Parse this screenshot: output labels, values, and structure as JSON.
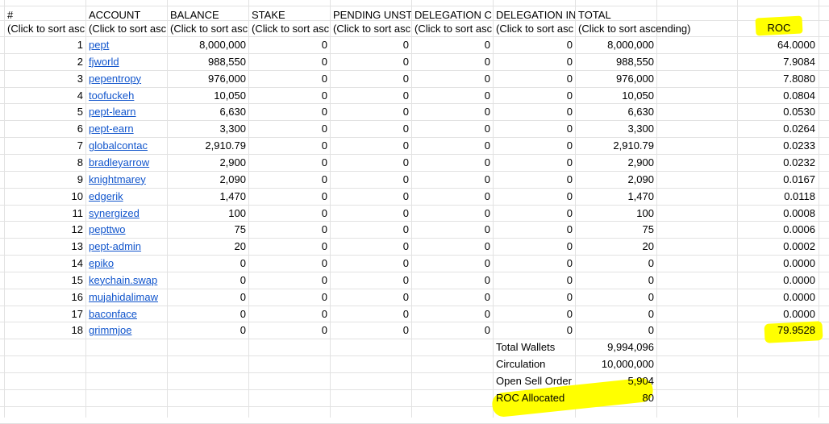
{
  "headers": [
    "#",
    "ACCOUNT",
    "BALANCE",
    "STAKE",
    "PENDING UNST",
    "DELEGATION C",
    "DELEGATION IN",
    "TOTAL",
    "",
    "ROC"
  ],
  "subheaders": [
    "(Click to sort asc",
    "(Click to sort asc",
    "(Click to sort asc",
    "(Click to sort asc",
    "(Click to sort asc",
    "(Click to sort asc",
    "(Click to sort asc",
    "(Click to sort ascending)"
  ],
  "rows": [
    {
      "n": "1",
      "account": "pept",
      "balance": "8,000,000",
      "stake": "0",
      "pending": "0",
      "delc": "0",
      "deli": "0",
      "total": "8,000,000",
      "roc": "64.0000"
    },
    {
      "n": "2",
      "account": "fjworld",
      "balance": "988,550",
      "stake": "0",
      "pending": "0",
      "delc": "0",
      "deli": "0",
      "total": "988,550",
      "roc": "7.9084"
    },
    {
      "n": "3",
      "account": "pepentropy",
      "balance": "976,000",
      "stake": "0",
      "pending": "0",
      "delc": "0",
      "deli": "0",
      "total": "976,000",
      "roc": "7.8080"
    },
    {
      "n": "4",
      "account": "toofuckeh",
      "balance": "10,050",
      "stake": "0",
      "pending": "0",
      "delc": "0",
      "deli": "0",
      "total": "10,050",
      "roc": "0.0804"
    },
    {
      "n": "5",
      "account": "pept-learn",
      "balance": "6,630",
      "stake": "0",
      "pending": "0",
      "delc": "0",
      "deli": "0",
      "total": "6,630",
      "roc": "0.0530"
    },
    {
      "n": "6",
      "account": "pept-earn",
      "balance": "3,300",
      "stake": "0",
      "pending": "0",
      "delc": "0",
      "deli": "0",
      "total": "3,300",
      "roc": "0.0264"
    },
    {
      "n": "7",
      "account": "globalcontac",
      "balance": "2,910.79",
      "stake": "0",
      "pending": "0",
      "delc": "0",
      "deli": "0",
      "total": "2,910.79",
      "roc": "0.0233"
    },
    {
      "n": "8",
      "account": "bradleyarrow",
      "balance": "2,900",
      "stake": "0",
      "pending": "0",
      "delc": "0",
      "deli": "0",
      "total": "2,900",
      "roc": "0.0232"
    },
    {
      "n": "9",
      "account": "knightmarey",
      "balance": "2,090",
      "stake": "0",
      "pending": "0",
      "delc": "0",
      "deli": "0",
      "total": "2,090",
      "roc": "0.0167"
    },
    {
      "n": "10",
      "account": "edgerik",
      "balance": "1,470",
      "stake": "0",
      "pending": "0",
      "delc": "0",
      "deli": "0",
      "total": "1,470",
      "roc": "0.0118"
    },
    {
      "n": "11",
      "account": "synergized",
      "balance": "100",
      "stake": "0",
      "pending": "0",
      "delc": "0",
      "deli": "0",
      "total": "100",
      "roc": "0.0008"
    },
    {
      "n": "12",
      "account": "pepttwo",
      "balance": "75",
      "stake": "0",
      "pending": "0",
      "delc": "0",
      "deli": "0",
      "total": "75",
      "roc": "0.0006"
    },
    {
      "n": "13",
      "account": "pept-admin",
      "balance": "20",
      "stake": "0",
      "pending": "0",
      "delc": "0",
      "deli": "0",
      "total": "20",
      "roc": "0.0002"
    },
    {
      "n": "14",
      "account": "epiko",
      "balance": "0",
      "stake": "0",
      "pending": "0",
      "delc": "0",
      "deli": "0",
      "total": "0",
      "roc": "0.0000"
    },
    {
      "n": "15",
      "account": "keychain.swap",
      "balance": "0",
      "stake": "0",
      "pending": "0",
      "delc": "0",
      "deli": "0",
      "total": "0",
      "roc": "0.0000"
    },
    {
      "n": "16",
      "account": "mujahidalimaw",
      "balance": "0",
      "stake": "0",
      "pending": "0",
      "delc": "0",
      "deli": "0",
      "total": "0",
      "roc": "0.0000"
    },
    {
      "n": "17",
      "account": "baconface",
      "balance": "0",
      "stake": "0",
      "pending": "0",
      "delc": "0",
      "deli": "0",
      "total": "0",
      "roc": "0.0000"
    },
    {
      "n": "18",
      "account": "grimmjoe",
      "balance": "0",
      "stake": "0",
      "pending": "0",
      "delc": "0",
      "deli": "0",
      "total": "0",
      "roc": "79.9528"
    }
  ],
  "summary": [
    {
      "label": "Total Wallets",
      "value": "9,994,096"
    },
    {
      "label": "Circulation",
      "value": "10,000,000"
    },
    {
      "label": "Open Sell Order",
      "value": "5,904"
    },
    {
      "label": "ROC Allocated",
      "value": "80"
    }
  ],
  "colors": {
    "highlight": "#ffff00",
    "link": "#1155cc",
    "gridline": "#e2e2e2"
  }
}
